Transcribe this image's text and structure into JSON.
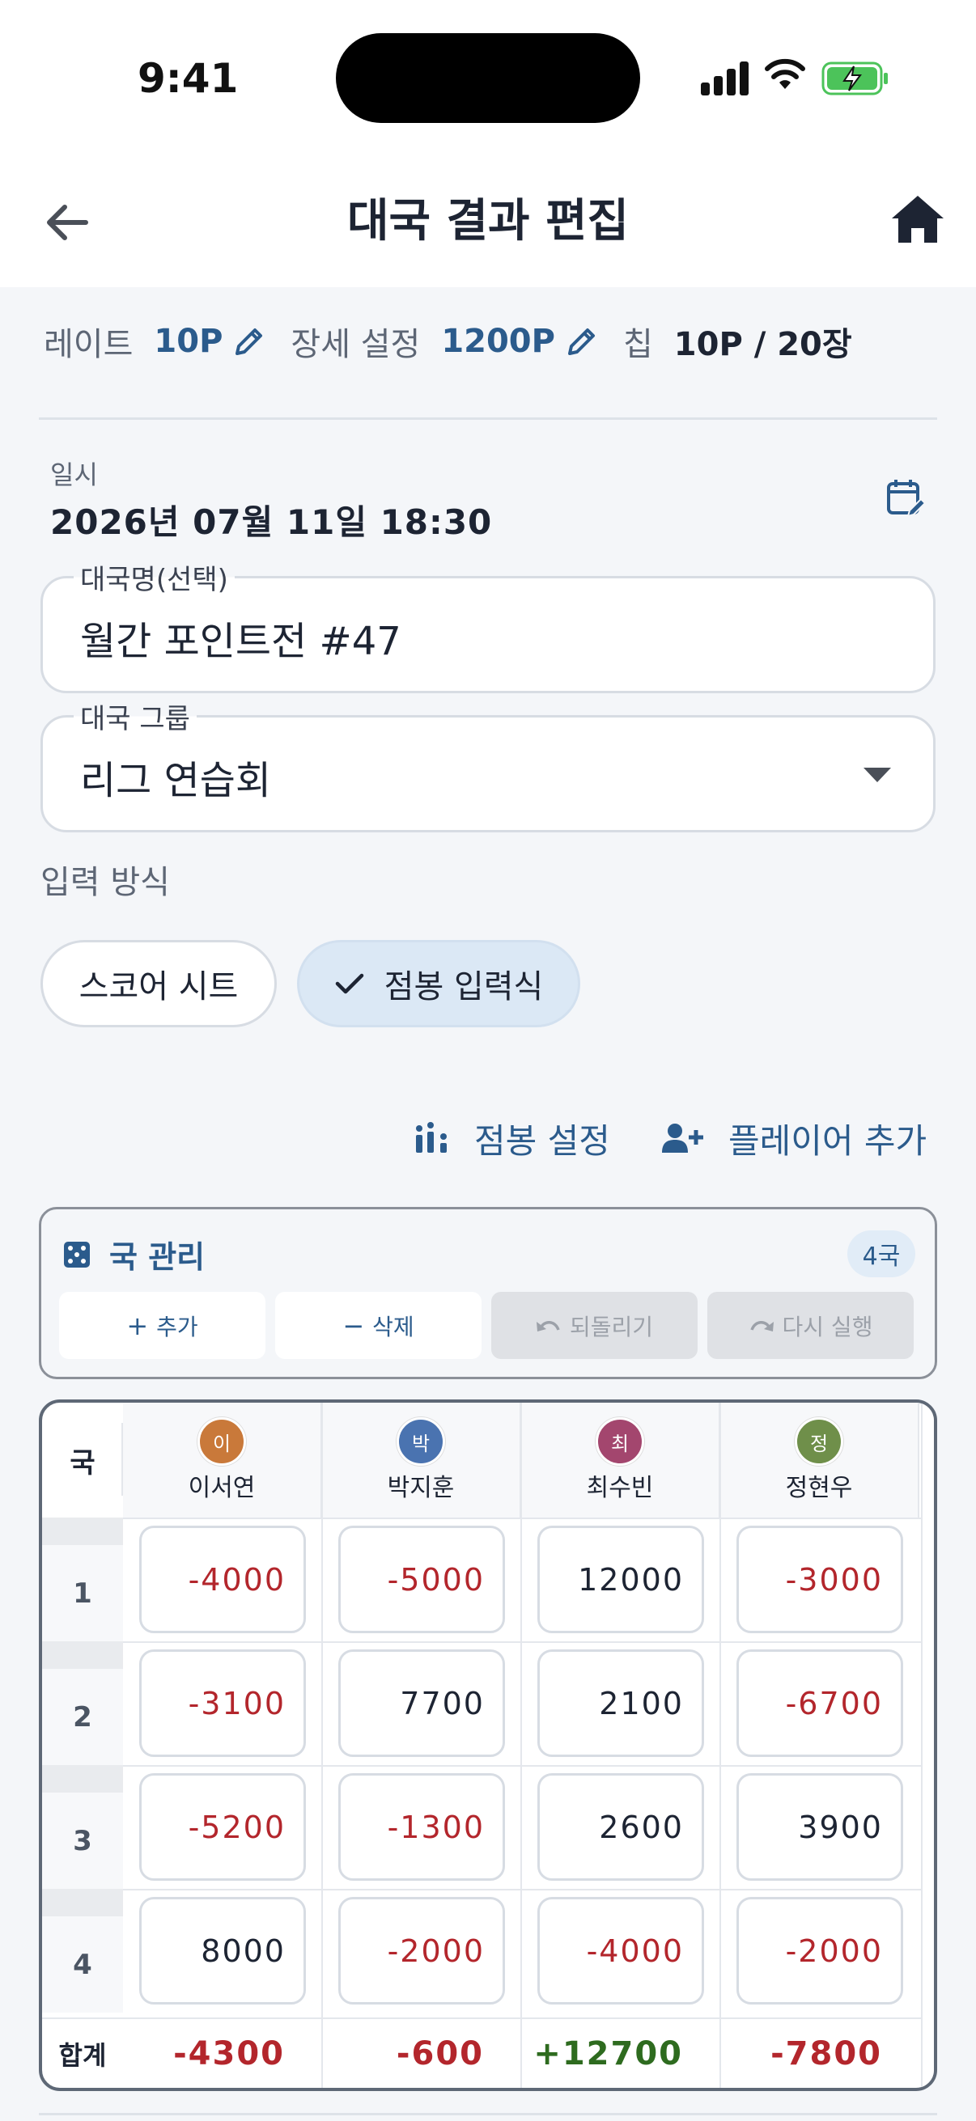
{
  "status": {
    "time": "9:41"
  },
  "appbar": {
    "title": "대국 결과 편집"
  },
  "settings": {
    "rate_label": "레이트",
    "rate_value": "10P",
    "field_label": "장세 설정",
    "field_value": "1200P",
    "chip_label": "칩",
    "chip_value": "10P / 20장"
  },
  "datetime": {
    "label": "일시",
    "value": "2026년 07월 11일 18:30"
  },
  "game_name": {
    "label": "대국명(선택)",
    "value": "월간 포인트전 #47"
  },
  "game_group": {
    "label": "대국 그룹",
    "value": "리그 연습회"
  },
  "input_mode": {
    "label": "입력 방식",
    "options": [
      {
        "label": "스코어 시트",
        "selected": false
      },
      {
        "label": "점봉 입력식",
        "selected": true
      }
    ]
  },
  "actions": {
    "stick_settings": "점봉 설정",
    "add_player": "플레이어 추가"
  },
  "round_panel": {
    "title": "국 관리",
    "count": "4국",
    "add": "추가",
    "delete": "삭제",
    "undo": "되돌리기",
    "redo": "다시 실행"
  },
  "table": {
    "corner": "국",
    "total_label": "합계",
    "players": [
      {
        "initial": "이",
        "name": "이서연",
        "color": "#c9793a"
      },
      {
        "initial": "박",
        "name": "박지훈",
        "color": "#4a73b0"
      },
      {
        "initial": "최",
        "name": "최수빈",
        "color": "#a3466e"
      },
      {
        "initial": "정",
        "name": "정현우",
        "color": "#6f8f4a"
      }
    ],
    "rows": [
      {
        "round": "1",
        "scores": [
          "-4000",
          "-5000",
          "12000",
          "-3000"
        ]
      },
      {
        "round": "2",
        "scores": [
          "-3100",
          "7700",
          "2100",
          "-6700"
        ]
      },
      {
        "round": "3",
        "scores": [
          "-5200",
          "-1300",
          "2600",
          "3900"
        ]
      },
      {
        "round": "4",
        "scores": [
          "8000",
          "-2000",
          "-4000",
          "-2000"
        ]
      }
    ],
    "totals": [
      "-4300",
      "-600",
      "+12700",
      "-7800"
    ]
  }
}
